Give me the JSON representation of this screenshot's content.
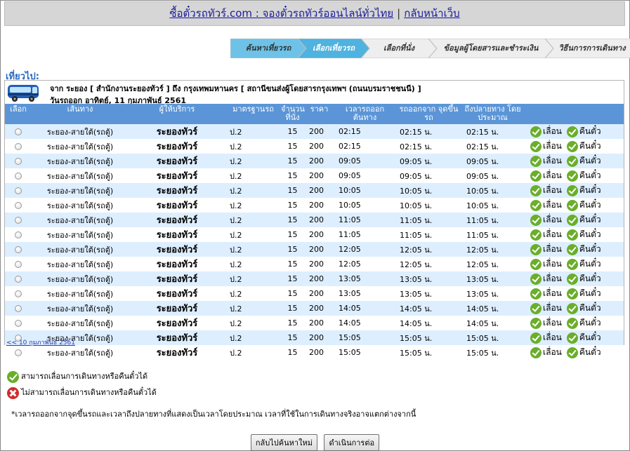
{
  "header": {
    "site_link": "ซื้อตั๋วรถทัวร์.com : จองตั๋วรถทัวร์ออนไลน์ทั่วไทย",
    "separator": "|",
    "home_link": "กลับหน้าเว็บ"
  },
  "steps": [
    {
      "label": "ค้นหาเที่ยวรถ",
      "state": "done"
    },
    {
      "label": "เลือกเที่ยวรถ",
      "state": "active"
    },
    {
      "label": "เลือกที่นั่ง",
      "state": "todo"
    },
    {
      "label": "ข้อมูลผู้โดยสารและชำระเงิน",
      "state": "todo"
    },
    {
      "label": "วิธีนการการเดินทาง",
      "state": "todo"
    }
  ],
  "colors": {
    "step_done": "#6ec2e8",
    "step_active": "#4fb2df",
    "step_todo": "#eeeeee",
    "table_header": "#5b95d7",
    "row_alt": "#ddeeff",
    "title_blue": "#2767c2"
  },
  "trip": {
    "section_title": "เที่ยวไป:",
    "route": "จาก ระยอง [ สำนักงานระยองทัวร์ ] ถึง กรุงเทพมหานคร [ สถานีขนส่งผู้โดยสารกรุงเทพฯ (ถนนบรมราชชนนี) ]",
    "date": "วันรถออก อาทิตย์, 11 กุมภาพันธ์ 2561",
    "bus_icon": "bus-icon"
  },
  "table": {
    "headers": [
      "เลือก",
      "เส้นทาง",
      "ผู้ให้บริการ",
      "มาตรฐานรถ",
      "จำนวน ที่นั่ง",
      "ราคา",
      "เวลารถออก ต้นทาง",
      "รถออกจาก จุดขึ้นรถ",
      "ถึงปลายทาง โดยประมาณ",
      ""
    ],
    "rows": [
      {
        "route": "ระยอง-สายใต้(รถตู้)",
        "operator": "ระยองทัวร์",
        "standard": "ป.2",
        "seats": "15",
        "price": "200",
        "depart": "02:15",
        "pickup": "02:15 น.",
        "arrive": "02:15 น.",
        "postpone": "เลื่อน",
        "refund": "คืนตั๋ว"
      },
      {
        "route": "ระยอง-สายใต้(รถตู้)",
        "operator": "ระยองทัวร์",
        "standard": "ป.2",
        "seats": "15",
        "price": "200",
        "depart": "02:15",
        "pickup": "02:15 น.",
        "arrive": "02:15 น.",
        "postpone": "เลื่อน",
        "refund": "คืนตั๋ว"
      },
      {
        "route": "ระยอง-สายใต้(รถตู้)",
        "operator": "ระยองทัวร์",
        "standard": "ป.2",
        "seats": "15",
        "price": "200",
        "depart": "09:05",
        "pickup": "09:05 น.",
        "arrive": "09:05 น.",
        "postpone": "เลื่อน",
        "refund": "คืนตั๋ว"
      },
      {
        "route": "ระยอง-สายใต้(รถตู้)",
        "operator": "ระยองทัวร์",
        "standard": "ป.2",
        "seats": "15",
        "price": "200",
        "depart": "09:05",
        "pickup": "09:05 น.",
        "arrive": "09:05 น.",
        "postpone": "เลื่อน",
        "refund": "คืนตั๋ว"
      },
      {
        "route": "ระยอง-สายใต้(รถตู้)",
        "operator": "ระยองทัวร์",
        "standard": "ป.2",
        "seats": "15",
        "price": "200",
        "depart": "10:05",
        "pickup": "10:05 น.",
        "arrive": "10:05 น.",
        "postpone": "เลื่อน",
        "refund": "คืนตั๋ว"
      },
      {
        "route": "ระยอง-สายใต้(รถตู้)",
        "operator": "ระยองทัวร์",
        "standard": "ป.2",
        "seats": "15",
        "price": "200",
        "depart": "10:05",
        "pickup": "10:05 น.",
        "arrive": "10:05 น.",
        "postpone": "เลื่อน",
        "refund": "คืนตั๋ว"
      },
      {
        "route": "ระยอง-สายใต้(รถตู้)",
        "operator": "ระยองทัวร์",
        "standard": "ป.2",
        "seats": "15",
        "price": "200",
        "depart": "11:05",
        "pickup": "11:05 น.",
        "arrive": "11:05 น.",
        "postpone": "เลื่อน",
        "refund": "คืนตั๋ว"
      },
      {
        "route": "ระยอง-สายใต้(รถตู้)",
        "operator": "ระยองทัวร์",
        "standard": "ป.2",
        "seats": "15",
        "price": "200",
        "depart": "11:05",
        "pickup": "11:05 น.",
        "arrive": "11:05 น.",
        "postpone": "เลื่อน",
        "refund": "คืนตั๋ว"
      },
      {
        "route": "ระยอง-สายใต้(รถตู้)",
        "operator": "ระยองทัวร์",
        "standard": "ป.2",
        "seats": "15",
        "price": "200",
        "depart": "12:05",
        "pickup": "12:05 น.",
        "arrive": "12:05 น.",
        "postpone": "เลื่อน",
        "refund": "คืนตั๋ว"
      },
      {
        "route": "ระยอง-สายใต้(รถตู้)",
        "operator": "ระยองทัวร์",
        "standard": "ป.2",
        "seats": "15",
        "price": "200",
        "depart": "12:05",
        "pickup": "12:05 น.",
        "arrive": "12:05 น.",
        "postpone": "เลื่อน",
        "refund": "คืนตั๋ว"
      },
      {
        "route": "ระยอง-สายใต้(รถตู้)",
        "operator": "ระยองทัวร์",
        "standard": "ป.2",
        "seats": "15",
        "price": "200",
        "depart": "13:05",
        "pickup": "13:05 น.",
        "arrive": "13:05 น.",
        "postpone": "เลื่อน",
        "refund": "คืนตั๋ว"
      },
      {
        "route": "ระยอง-สายใต้(รถตู้)",
        "operator": "ระยองทัวร์",
        "standard": "ป.2",
        "seats": "15",
        "price": "200",
        "depart": "13:05",
        "pickup": "13:05 น.",
        "arrive": "13:05 น.",
        "postpone": "เลื่อน",
        "refund": "คืนตั๋ว"
      },
      {
        "route": "ระยอง-สายใต้(รถตู้)",
        "operator": "ระยองทัวร์",
        "standard": "ป.2",
        "seats": "15",
        "price": "200",
        "depart": "14:05",
        "pickup": "14:05 น.",
        "arrive": "14:05 น.",
        "postpone": "เลื่อน",
        "refund": "คืนตั๋ว"
      },
      {
        "route": "ระยอง-สายใต้(รถตู้)",
        "operator": "ระยองทัวร์",
        "standard": "ป.2",
        "seats": "15",
        "price": "200",
        "depart": "14:05",
        "pickup": "14:05 น.",
        "arrive": "14:05 น.",
        "postpone": "เลื่อน",
        "refund": "คืนตั๋ว"
      },
      {
        "route": "ระยอง-สายใต้(รถตู้)",
        "operator": "ระยองทัวร์",
        "standard": "ป.2",
        "seats": "15",
        "price": "200",
        "depart": "15:05",
        "pickup": "15:05 น.",
        "arrive": "15:05 น.",
        "postpone": "เลื่อน",
        "refund": "คืนตั๋ว"
      },
      {
        "route": "ระยอง-สายใต้(รถตู้)",
        "operator": "ระยองทัวร์",
        "standard": "ป.2",
        "seats": "15",
        "price": "200",
        "depart": "15:05",
        "pickup": "15:05 น.",
        "arrive": "15:05 น.",
        "postpone": "เลื่อน",
        "refund": "คืนตั๋ว"
      }
    ],
    "prev_day_link": "<< 10 กุมภาพันธ์ 2561"
  },
  "legend": {
    "can_change": "สามารถเลื่อนการเดินทางหรือคืนตั๋วได้",
    "cannot_change": "ไม่สามารถเลื่อนการเดินทางหรือคืนตั๋วได้",
    "note": "*เวลารถออกจากจุดขึ้นรถและเวลาถึงปลายทางที่แสดงเป็นเวลาโดยประมาณ เวลาที่ใช้ในการเดินทางจริงอาจแตกต่างจากนี้"
  },
  "buttons": {
    "back": "กลับไปค้นหาใหม่",
    "continue": "ดำเนินการต่อ"
  }
}
